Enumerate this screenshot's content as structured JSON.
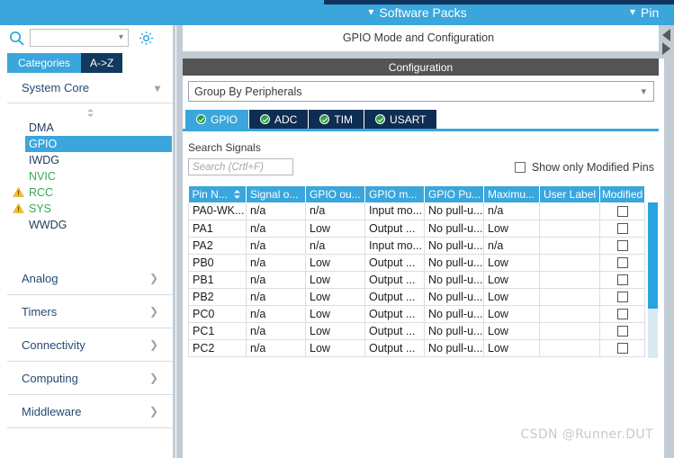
{
  "menubar": {
    "items": [
      {
        "label": "Software Packs",
        "icon": "chevron-down-icon"
      },
      {
        "label": "Pin",
        "icon": "chevron-down-icon"
      }
    ]
  },
  "sidebar": {
    "search": {
      "value": "",
      "placeholder": "",
      "icon": "search-icon",
      "arrow": "chevron-down-icon"
    },
    "settings_icon": "gear-icon",
    "tabs": [
      {
        "label": "Categories",
        "active": true
      },
      {
        "label": "A->Z",
        "active": false
      }
    ],
    "group": {
      "label": "System Core",
      "chevron": "chevron-down-icon",
      "items": [
        {
          "label": "DMA",
          "state": "normal",
          "warning": false
        },
        {
          "label": "GPIO",
          "state": "selected",
          "warning": false
        },
        {
          "label": "IWDG",
          "state": "normal",
          "warning": false
        },
        {
          "label": "NVIC",
          "state": "green",
          "warning": false
        },
        {
          "label": "RCC",
          "state": "green",
          "warning": true
        },
        {
          "label": "SYS",
          "state": "green",
          "warning": true
        },
        {
          "label": "WWDG",
          "state": "normal",
          "warning": false
        }
      ]
    },
    "categories": [
      {
        "label": "Analog",
        "chevron": "chevron-right-icon"
      },
      {
        "label": "Timers",
        "chevron": "chevron-right-icon"
      },
      {
        "label": "Connectivity",
        "chevron": "chevron-right-icon"
      },
      {
        "label": "Computing",
        "chevron": "chevron-right-icon"
      },
      {
        "label": "Middleware",
        "chevron": "chevron-right-icon"
      }
    ]
  },
  "main": {
    "mode_title": "GPIO Mode and Configuration",
    "config_bar": "Configuration",
    "group_by": {
      "value": "Group By Peripherals",
      "arrow": "chevron-down-icon"
    },
    "peripheral_tabs": [
      {
        "label": "GPIO",
        "active": true,
        "icon": "check-circle-icon"
      },
      {
        "label": "ADC",
        "active": false,
        "icon": "check-circle-icon"
      },
      {
        "label": "TIM",
        "active": false,
        "icon": "check-circle-icon"
      },
      {
        "label": "USART",
        "active": false,
        "icon": "check-circle-icon"
      }
    ],
    "search_signals": {
      "label": "Search Signals",
      "value": "",
      "placeholder": "Search (Crtl+F)"
    },
    "show_modified": {
      "label": "Show only Modified Pins",
      "checked": false
    },
    "table": {
      "columns": [
        "Pin N...",
        "Signal o...",
        "GPIO ou...",
        "GPIO m...",
        "GPIO Pu...",
        "Maximu...",
        "User Label",
        "Modified"
      ],
      "sorted_column": 0,
      "sort_icon": "sort-updown-icon",
      "rows": [
        {
          "pin": "PA0-WK...",
          "signal": "n/a",
          "output": "n/a",
          "mode": "Input mo...",
          "pull": "No pull-u...",
          "speed": "n/a",
          "label": "",
          "modified": false
        },
        {
          "pin": "PA1",
          "signal": "n/a",
          "output": "Low",
          "mode": "Output ...",
          "pull": "No pull-u...",
          "speed": "Low",
          "label": "",
          "modified": false
        },
        {
          "pin": "PA2",
          "signal": "n/a",
          "output": "n/a",
          "mode": "Input mo...",
          "pull": "No pull-u...",
          "speed": "n/a",
          "label": "",
          "modified": false
        },
        {
          "pin": "PB0",
          "signal": "n/a",
          "output": "Low",
          "mode": "Output ...",
          "pull": "No pull-u...",
          "speed": "Low",
          "label": "",
          "modified": false
        },
        {
          "pin": "PB1",
          "signal": "n/a",
          "output": "Low",
          "mode": "Output ...",
          "pull": "No pull-u...",
          "speed": "Low",
          "label": "",
          "modified": false
        },
        {
          "pin": "PB2",
          "signal": "n/a",
          "output": "Low",
          "mode": "Output ...",
          "pull": "No pull-u...",
          "speed": "Low",
          "label": "",
          "modified": false
        },
        {
          "pin": "PC0",
          "signal": "n/a",
          "output": "Low",
          "mode": "Output ...",
          "pull": "No pull-u...",
          "speed": "Low",
          "label": "",
          "modified": false
        },
        {
          "pin": "PC1",
          "signal": "n/a",
          "output": "Low",
          "mode": "Output ...",
          "pull": "No pull-u...",
          "speed": "Low",
          "label": "",
          "modified": false
        },
        {
          "pin": "PC2",
          "signal": "n/a",
          "output": "Low",
          "mode": "Output ...",
          "pull": "No pull-u...",
          "speed": "Low",
          "label": "",
          "modified": false
        }
      ]
    }
  },
  "watermark": "CSDN @Runner.DUT",
  "colors": {
    "accent_blue": "#3aa6dc",
    "navy": "#0f2d52",
    "dark_gray_bar": "#545454",
    "panel_gray": "#c2ccd4",
    "green_text": "#34a853",
    "warning_yellow": "#f5c026"
  }
}
